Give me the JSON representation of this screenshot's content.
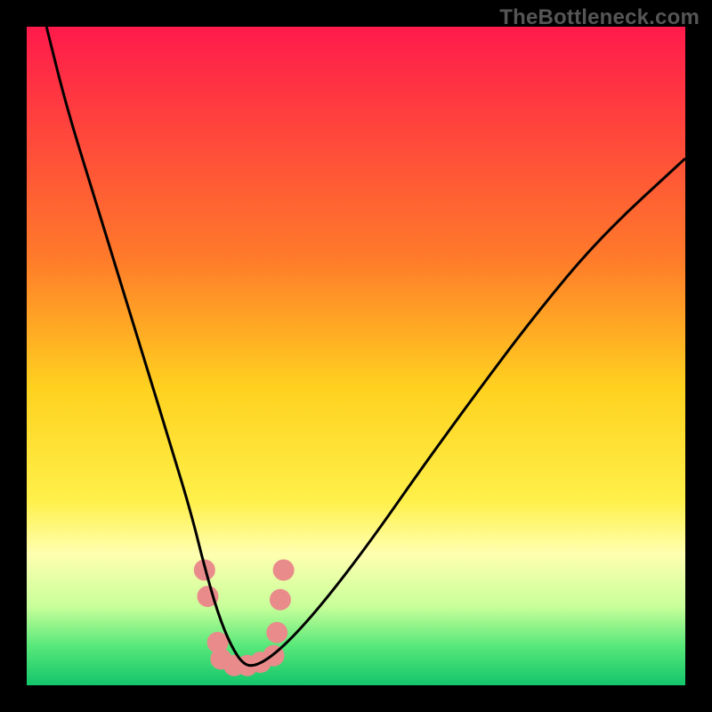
{
  "watermark": {
    "text": "TheBottleneck.com"
  },
  "chart_data": {
    "type": "line",
    "title": "",
    "xlabel": "",
    "ylabel": "",
    "xlim": [
      0,
      100
    ],
    "ylim": [
      0,
      100
    ],
    "grid": false,
    "legend": false,
    "gradient_stops": [
      {
        "offset": 0,
        "color": "#ff1a4b"
      },
      {
        "offset": 35,
        "color": "#ff7a2a"
      },
      {
        "offset": 55,
        "color": "#ffd21f"
      },
      {
        "offset": 72,
        "color": "#fff04a"
      },
      {
        "offset": 80,
        "color": "#ffffb0"
      },
      {
        "offset": 88,
        "color": "#c9ff9a"
      },
      {
        "offset": 94,
        "color": "#58e87a"
      },
      {
        "offset": 100,
        "color": "#13c56b"
      }
    ],
    "series": [
      {
        "name": "bottleneck-curve",
        "stroke": "#000000",
        "x": [
          3,
          6,
          10,
          14,
          18,
          22,
          25,
          27,
          29,
          31,
          33,
          35,
          38,
          42,
          47,
          53,
          60,
          68,
          77,
          87,
          100
        ],
        "y": [
          100,
          88,
          75,
          62,
          49,
          36,
          26,
          18,
          11,
          6,
          3,
          3,
          5,
          9,
          15,
          23,
          33,
          44,
          56,
          68,
          80
        ]
      }
    ],
    "markers": {
      "name": "highlight-dots",
      "color": "#e98b8b",
      "radius": 12,
      "points": [
        {
          "x": 27.0,
          "y": 17.5
        },
        {
          "x": 27.5,
          "y": 13.5
        },
        {
          "x": 29.0,
          "y": 6.5
        },
        {
          "x": 29.5,
          "y": 4.0
        },
        {
          "x": 31.5,
          "y": 3.0
        },
        {
          "x": 33.5,
          "y": 3.0
        },
        {
          "x": 35.5,
          "y": 3.5
        },
        {
          "x": 37.5,
          "y": 4.5
        },
        {
          "x": 38.0,
          "y": 8.0
        },
        {
          "x": 38.5,
          "y": 13.0
        },
        {
          "x": 39.0,
          "y": 17.5
        }
      ]
    }
  }
}
